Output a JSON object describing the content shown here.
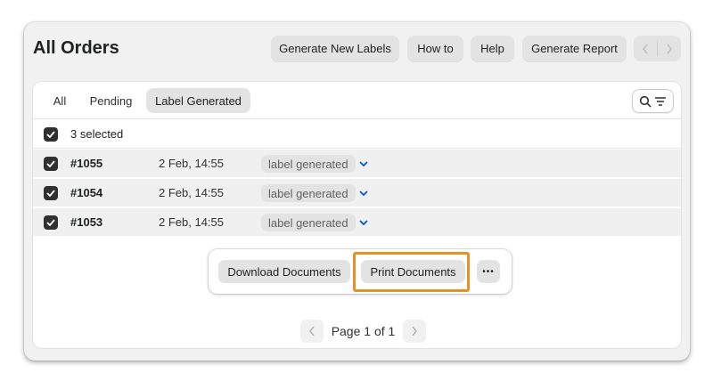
{
  "header": {
    "title": "All Orders",
    "buttons": {
      "generate_labels": "Generate New Labels",
      "how_to": "How to",
      "help": "Help",
      "generate_report": "Generate Report"
    }
  },
  "tabs": [
    {
      "label": "All",
      "active": false
    },
    {
      "label": "Pending",
      "active": false
    },
    {
      "label": "Label Generated",
      "active": true
    }
  ],
  "selection": {
    "label": "3 selected",
    "checked": true
  },
  "orders": [
    {
      "id": "#1055",
      "date": "2 Feb, 14:55",
      "status": "label generated",
      "checked": true
    },
    {
      "id": "#1054",
      "date": "2 Feb, 14:55",
      "status": "label generated",
      "checked": true
    },
    {
      "id": "#1053",
      "date": "2 Feb, 14:55",
      "status": "label generated",
      "checked": true
    }
  ],
  "bulk_actions": {
    "download": "Download Documents",
    "print": "Print Documents",
    "more": "•••"
  },
  "pagination": {
    "label": "Page 1 of 1"
  },
  "colors": {
    "highlight": "#e8911e",
    "accent_chevron": "#005bd3",
    "checkbox": "#303030"
  },
  "icons": {
    "search": "search-icon",
    "filter": "filter-icon",
    "prev": "chevron-left-icon",
    "next": "chevron-right-icon",
    "expand": "chevron-down-icon",
    "check": "checkmark-icon"
  }
}
